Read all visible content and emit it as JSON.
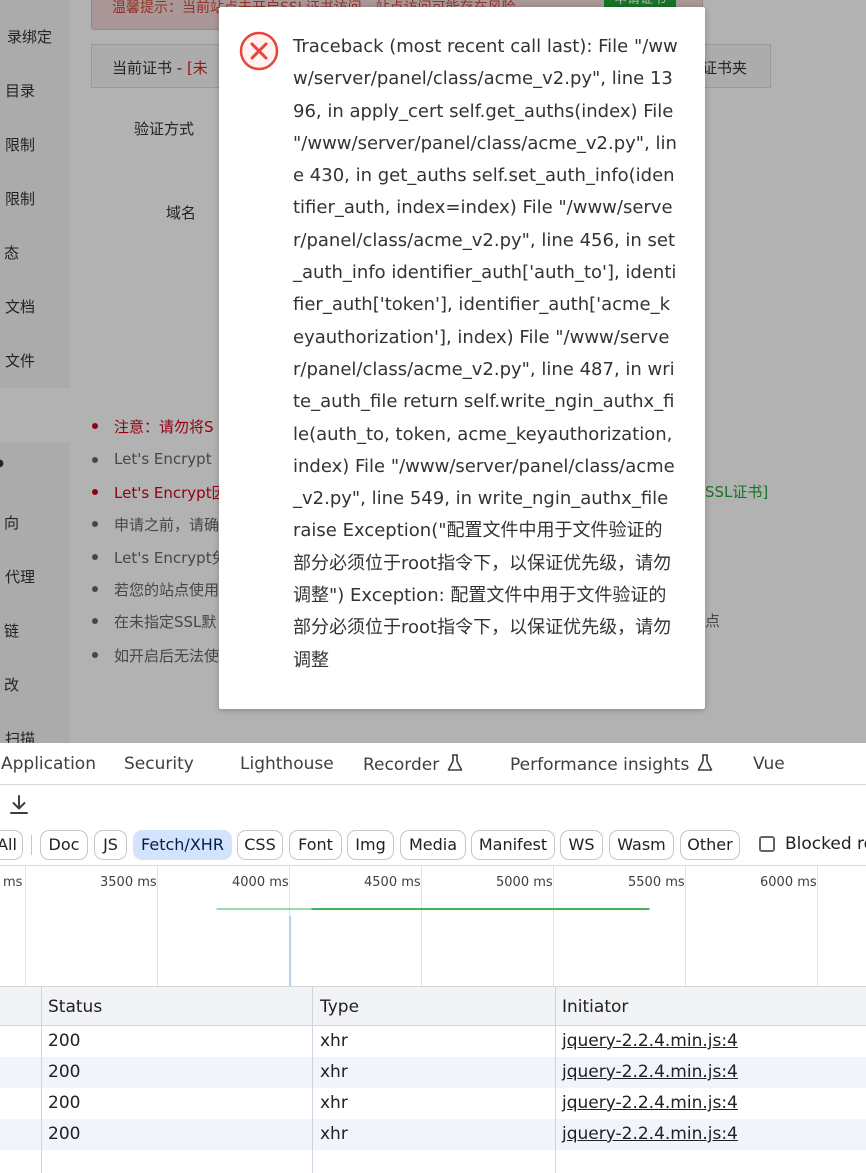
{
  "sidebar": {
    "items": [
      "录绑定",
      "目录",
      "限制",
      "限制",
      "态",
      "文档",
      "文件",
      "",
      "向",
      "代理",
      "链",
      "改",
      "扫描"
    ]
  },
  "page": {
    "warning_text": "温馨提示：当前站点未开启SSL证书访问，站点访问可能存在风险",
    "warning_button": "申请证书",
    "cert_label": "当前证书 - ",
    "cert_status": "[未",
    "cert_right": "证书夹",
    "verify_label": "验证方式",
    "domain_label": "域名",
    "notes": [
      {
        "text": "注意：请勿将S",
        "red": true
      },
      {
        "text": "Let's Encrypt",
        "red": false
      },
      {
        "text": "Let's Encrypt因",
        "red": true
      },
      {
        "text": "申请之前，请确",
        "red": false
      },
      {
        "text": "Let's Encrypt免",
        "red": false
      },
      {
        "text": "若您的站点使用",
        "red": false
      },
      {
        "text": "在未指定SSL默",
        "red": false
      },
      {
        "text": "如开启后无法使",
        "red": false
      }
    ],
    "note_right_ssl": "SSL证书]",
    "note_right_dian": "点"
  },
  "dialog": {
    "icon": "error-circle-x-icon",
    "message": "Traceback (most recent call last): File \"/www/server/panel/class/acme_v2.py\", line 1396, in apply_cert self.get_auths(index) File \"/www/server/panel/class/acme_v2.py\", line 430, in get_auths self.set_auth_info(identifier_auth, index=index) File \"/www/server/panel/class/acme_v2.py\", line 456, in set_auth_info identifier_auth['auth_to'], identifier_auth['token'], identifier_auth['acme_keyauthorization'], index) File \"/www/server/panel/class/acme_v2.py\", line 487, in write_auth_file return self.write_ngin_authx_file(auth_to, token, acme_keyauthorization, index) File \"/www/server/panel/class/acme_v2.py\", line 549, in write_ngin_authx_file raise Exception(\"配置文件中用于文件验证的部分必须位于root指令下，以保证优先级，请勿调整\") Exception: 配置文件中用于文件验证的部分必须位于root指令下，以保证优先级，请勿调整"
  },
  "devtools": {
    "tabs": [
      "Application",
      "Security",
      "Lighthouse",
      "Recorder",
      "Performance insights",
      "Vue"
    ],
    "filters": [
      "All",
      "Doc",
      "JS",
      "Fetch/XHR",
      "CSS",
      "Font",
      "Img",
      "Media",
      "Manifest",
      "WS",
      "Wasm",
      "Other"
    ],
    "selected_filter": "Fetch/XHR",
    "blocked_label": "Blocked re",
    "timeline_ticks": [
      "ms",
      "3500 ms",
      "4000 ms",
      "4500 ms",
      "5000 ms",
      "5500 ms",
      "6000 ms"
    ],
    "columns": [
      "Status",
      "Type",
      "Initiator"
    ],
    "rows": [
      {
        "status": "200",
        "type": "xhr",
        "initiator": "jquery-2.2.4.min.js:4"
      },
      {
        "status": "200",
        "type": "xhr",
        "initiator": "jquery-2.2.4.min.js:4"
      },
      {
        "status": "200",
        "type": "xhr",
        "initiator": "jquery-2.2.4.min.js:4"
      },
      {
        "status": "200",
        "type": "xhr",
        "initiator": "jquery-2.2.4.min.js:4"
      }
    ]
  },
  "colors": {
    "error_red": "#e5453a",
    "success_green": "#20a53a",
    "selected_chip": "#d3e3fd",
    "timeline_green": "#3fb55e"
  }
}
